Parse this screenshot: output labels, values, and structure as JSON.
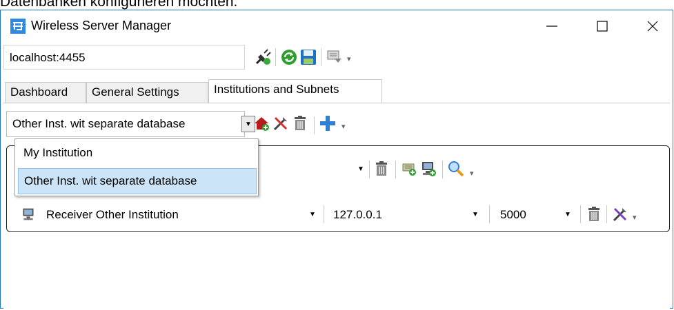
{
  "top_text": "Datenbanken konfigurieren möchten.",
  "window": {
    "title": "Wireless Server Manager",
    "minimize_label": "—",
    "maximize_label": "☐",
    "close_label": "✕"
  },
  "connection": {
    "address": "localhost:4455"
  },
  "tabs": [
    {
      "label": "Dashboard"
    },
    {
      "label": "General Settings"
    },
    {
      "label": "Institutions and Subnets"
    }
  ],
  "institution": {
    "selected": "Other Inst. wit separate database",
    "options": [
      "My Institution",
      "Other Inst. wit separate database"
    ]
  },
  "receiver": {
    "name": "Receiver Other Institution",
    "ip": "127.0.0.1",
    "port": "5000"
  },
  "colors": {
    "window_border": "#1e73c6",
    "selected_item_bg": "#cce4f7",
    "selected_item_border": "#8ec3ee"
  },
  "icons": [
    "app-icon",
    "disconnect-icon",
    "refresh-icon",
    "save-icon",
    "settings-export-icon",
    "add-institution-icon",
    "edit-tools-icon",
    "delete-icon",
    "add-icon",
    "add-subnet-icon",
    "add-receiver-icon",
    "search-icon",
    "receiver-icon",
    "dropdown-arrow-icon",
    "overflow-icon"
  ]
}
